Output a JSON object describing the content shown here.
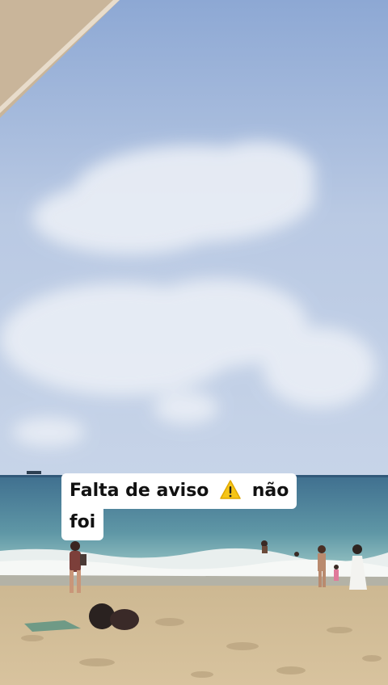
{
  "video_frame": {
    "subject": "beach-scene",
    "caption": {
      "line1": "Falta de aviso",
      "emoji_icon": "warning-sign-icon",
      "line1_end": "não",
      "line2": "foi"
    }
  }
}
